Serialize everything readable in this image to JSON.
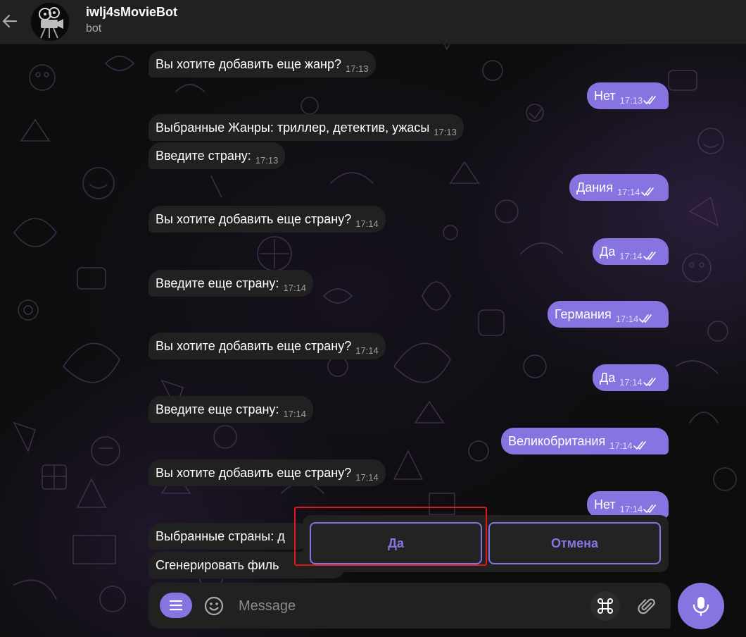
{
  "header": {
    "title": "iwlj4sMovieBot",
    "status": "bot"
  },
  "messages": [
    {
      "side": "in",
      "text": "Вы хотите добавить еще жанр?",
      "time": "17:13"
    },
    {
      "side": "out",
      "text": "Нет",
      "time": "17:13"
    },
    {
      "side": "in",
      "text": "Выбранные Жанры: триллер, детектив, ужасы",
      "time": "17:13"
    },
    {
      "side": "in",
      "text": "Введите страну:",
      "time": "17:13"
    },
    {
      "side": "out",
      "text": "Дания",
      "time": "17:14"
    },
    {
      "side": "in",
      "text": "Вы хотите добавить еще страну?",
      "time": "17:14"
    },
    {
      "side": "out",
      "text": "Да",
      "time": "17:14"
    },
    {
      "side": "in",
      "text": "Введите еще страну:",
      "time": "17:14"
    },
    {
      "side": "out",
      "text": "Германия",
      "time": "17:14"
    },
    {
      "side": "in",
      "text": "Вы хотите добавить еще страну?",
      "time": "17:14"
    },
    {
      "side": "out",
      "text": "Да",
      "time": "17:14"
    },
    {
      "side": "in",
      "text": "Введите еще страну:",
      "time": "17:14"
    },
    {
      "side": "out",
      "text": "Великобритания",
      "time": "17:14"
    },
    {
      "side": "in",
      "text": "Вы хотите добавить еще страну?",
      "time": "17:14"
    },
    {
      "side": "out",
      "text": "Нет",
      "time": "17:14"
    },
    {
      "side": "in",
      "text": "Выбранные страны: д",
      "time": ""
    },
    {
      "side": "in",
      "text": "Сгенерировать филь",
      "time": ""
    }
  ],
  "keyboard": {
    "buttons": [
      "Да",
      "Отмена"
    ]
  },
  "composer": {
    "placeholder": "Message"
  },
  "icons": {
    "back": "arrow-left-icon",
    "menu": "bot-menu-icon",
    "emoji": "smile-icon",
    "commands": "command-icon",
    "attach": "paperclip-icon",
    "mic": "microphone-icon"
  },
  "colors": {
    "accent": "#8774e1",
    "incoming_bubble": "#212121",
    "header": "#212121",
    "highlight": "#e0181a"
  }
}
